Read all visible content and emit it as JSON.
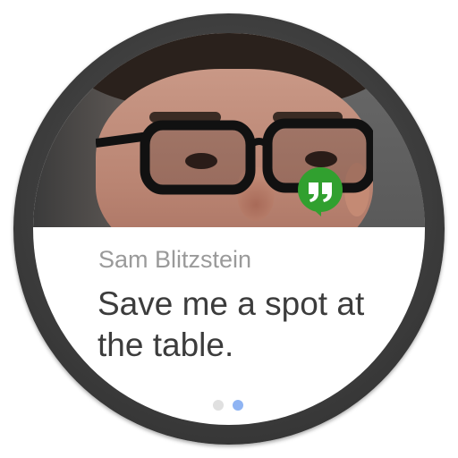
{
  "notification": {
    "sender_name": "Sam Blitzstein",
    "message": "Save me a spot at the table.",
    "app_icon": "hangouts-quote-icon",
    "avatar": "sender-photo"
  },
  "pagination": {
    "total_pages": 2,
    "current_page": 2
  },
  "colors": {
    "hangouts_green": "#31a02f",
    "active_dot": "#8fb4f3",
    "inactive_dot": "#e0e0e0",
    "name_text": "#9a9a9a",
    "message_text": "#3c3c3c",
    "bezel": "#3d3d3d"
  }
}
